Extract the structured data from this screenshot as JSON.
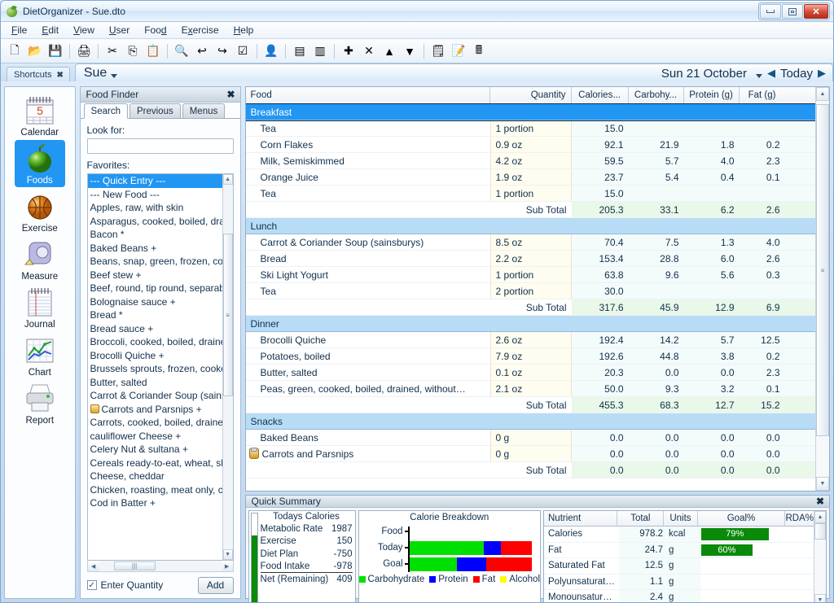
{
  "window": {
    "title": "DietOrganizer - Sue.dto",
    "icon": "apple-icon",
    "buttons": {
      "minimize": "minimize-icon",
      "maximize": "maximize-icon",
      "close": "✕"
    }
  },
  "menubar": {
    "items": [
      "File",
      "Edit",
      "View",
      "User",
      "Food",
      "Exercise",
      "Help"
    ]
  },
  "toolbar": {
    "items": [
      {
        "name": "new-file-icon",
        "glyph": "🗋"
      },
      {
        "name": "open-folder-icon",
        "glyph": "📂"
      },
      {
        "name": "save-icon",
        "glyph": "💾"
      },
      {
        "sep": true
      },
      {
        "name": "print-icon",
        "glyph": "🖨"
      },
      {
        "sep": true
      },
      {
        "name": "cut-icon",
        "glyph": "✂"
      },
      {
        "name": "copy-icon",
        "glyph": "⎘"
      },
      {
        "name": "paste-icon",
        "glyph": "📋"
      },
      {
        "sep": true
      },
      {
        "name": "search-icon",
        "glyph": "🔍"
      },
      {
        "name": "undo-icon",
        "glyph": "↩"
      },
      {
        "name": "redo-icon",
        "glyph": "↪"
      },
      {
        "name": "checklist-icon",
        "glyph": "☑"
      },
      {
        "sep": true
      },
      {
        "name": "user-icon",
        "glyph": "👤"
      },
      {
        "sep": true
      },
      {
        "name": "split-vertical-icon",
        "glyph": "▤"
      },
      {
        "name": "split-horizontal-icon",
        "glyph": "▥"
      },
      {
        "sep": true
      },
      {
        "name": "add-icon",
        "glyph": "✚"
      },
      {
        "name": "delete-icon",
        "glyph": "✕"
      },
      {
        "name": "move-up-icon",
        "glyph": "▲"
      },
      {
        "name": "move-down-icon",
        "glyph": "▼"
      },
      {
        "sep": true
      },
      {
        "name": "notes-icon",
        "glyph": "🗒"
      },
      {
        "name": "edit-note-icon",
        "glyph": "📝"
      },
      {
        "name": "calculator-icon",
        "glyph": "🖩"
      }
    ]
  },
  "shortcuts_tab": {
    "label": "Shortcuts",
    "close": "✖"
  },
  "user_bar": {
    "name": "Sue"
  },
  "date_nav": {
    "date": "Sun 21 October",
    "prev": "◀",
    "today": "Today",
    "next": "▶"
  },
  "rail": {
    "items": [
      {
        "label": "Calendar",
        "icon": "calendar-icon",
        "selected": false
      },
      {
        "label": "Foods",
        "icon": "apple-icon",
        "selected": true
      },
      {
        "label": "Exercise",
        "icon": "basketball-icon",
        "selected": false
      },
      {
        "label": "Measure",
        "icon": "tape-measure-icon",
        "selected": false
      },
      {
        "label": "Journal",
        "icon": "notebook-icon",
        "selected": false
      },
      {
        "label": "Chart",
        "icon": "line-chart-icon",
        "selected": false
      },
      {
        "label": "Report",
        "icon": "printer-icon",
        "selected": false
      }
    ]
  },
  "food_finder": {
    "caption": "Food Finder",
    "close": "✖",
    "tabs": [
      {
        "label": "Search",
        "active": true
      },
      {
        "label": "Previous",
        "active": false
      },
      {
        "label": "Menus",
        "active": false
      }
    ],
    "look_for_label": "Look for:",
    "look_for_value": "",
    "look_for_placeholder": "",
    "favorites_label": "Favorites:",
    "favorites": [
      {
        "label": "--- Quick Entry ---",
        "selected": true,
        "icon": ""
      },
      {
        "label": "--- New Food ---",
        "selected": false,
        "icon": ""
      },
      {
        "label": "Apples, raw, with skin",
        "selected": false,
        "icon": ""
      },
      {
        "label": "Asparagus, cooked, boiled, drain",
        "selected": false,
        "icon": ""
      },
      {
        "label": "Bacon *",
        "selected": false,
        "icon": ""
      },
      {
        "label": "Baked Beans +",
        "selected": false,
        "icon": ""
      },
      {
        "label": "Beans, snap, green, frozen, cook",
        "selected": false,
        "icon": ""
      },
      {
        "label": "Beef stew +",
        "selected": false,
        "icon": ""
      },
      {
        "label": "Beef, round, tip round, separable",
        "selected": false,
        "icon": ""
      },
      {
        "label": "Bolognaise sauce +",
        "selected": false,
        "icon": ""
      },
      {
        "label": "Bread *",
        "selected": false,
        "icon": ""
      },
      {
        "label": "Bread sauce +",
        "selected": false,
        "icon": ""
      },
      {
        "label": "Broccoli, cooked, boiled, drained,",
        "selected": false,
        "icon": ""
      },
      {
        "label": "Brocolli Quiche +",
        "selected": false,
        "icon": ""
      },
      {
        "label": "Brussels sprouts, frozen, cooked",
        "selected": false,
        "icon": ""
      },
      {
        "label": "Butter, salted",
        "selected": false,
        "icon": ""
      },
      {
        "label": "Carrot & Coriander Soup (sainsbu",
        "selected": false,
        "icon": ""
      },
      {
        "label": "Carrots and Parsnips +",
        "selected": false,
        "icon": "jar-icon"
      },
      {
        "label": "Carrots, cooked, boiled, drained,",
        "selected": false,
        "icon": ""
      },
      {
        "label": "cauliflower Cheese +",
        "selected": false,
        "icon": ""
      },
      {
        "label": "Celery Nut & sultana +",
        "selected": false,
        "icon": ""
      },
      {
        "label": "Cereals ready-to-eat, wheat, shre",
        "selected": false,
        "icon": ""
      },
      {
        "label": "Cheese, cheddar",
        "selected": false,
        "icon": ""
      },
      {
        "label": "Chicken, roasting, meat only, coo",
        "selected": false,
        "icon": ""
      },
      {
        "label": "Cod in Batter +",
        "selected": false,
        "icon": ""
      }
    ],
    "enter_quantity_label": "Enter Quantity",
    "enter_quantity_checked": true,
    "add_button": "Add"
  },
  "food_grid": {
    "columns": [
      "Food",
      "Quantity",
      "Calories...",
      "Carbohy...",
      "Protein (g)",
      "Fat (g)"
    ],
    "sections": [
      {
        "name": "Breakfast",
        "selected": true,
        "rows": [
          {
            "food": "Tea",
            "qty": "1 portion",
            "cal": "15.0",
            "carb": "",
            "pro": "",
            "fat": "",
            "icon": ""
          },
          {
            "food": "Corn Flakes",
            "qty": "0.9 oz",
            "cal": "92.1",
            "carb": "21.9",
            "pro": "1.8",
            "fat": "0.2",
            "icon": ""
          },
          {
            "food": "Milk, Semiskimmed",
            "qty": "4.2 oz",
            "cal": "59.5",
            "carb": "5.7",
            "pro": "4.0",
            "fat": "2.3",
            "icon": ""
          },
          {
            "food": "Orange Juice",
            "qty": "1.9 oz",
            "cal": "23.7",
            "carb": "5.4",
            "pro": "0.4",
            "fat": "0.1",
            "icon": ""
          },
          {
            "food": "Tea",
            "qty": "1 portion",
            "cal": "15.0",
            "carb": "",
            "pro": "",
            "fat": "",
            "icon": ""
          }
        ],
        "subtotal": {
          "label": "Sub Total",
          "cal": "205.3",
          "carb": "33.1",
          "pro": "6.2",
          "fat": "2.6"
        }
      },
      {
        "name": "Lunch",
        "selected": false,
        "rows": [
          {
            "food": "Carrot & Coriander Soup (sainsburys)",
            "qty": "8.5 oz",
            "cal": "70.4",
            "carb": "7.5",
            "pro": "1.3",
            "fat": "4.0",
            "icon": ""
          },
          {
            "food": "Bread",
            "qty": "2.2 oz",
            "cal": "153.4",
            "carb": "28.8",
            "pro": "6.0",
            "fat": "2.6",
            "icon": ""
          },
          {
            "food": "Ski Light Yogurt",
            "qty": "1 portion",
            "cal": "63.8",
            "carb": "9.6",
            "pro": "5.6",
            "fat": "0.3",
            "icon": ""
          },
          {
            "food": "Tea",
            "qty": "2 portion",
            "cal": "30.0",
            "carb": "",
            "pro": "",
            "fat": "",
            "icon": ""
          }
        ],
        "subtotal": {
          "label": "Sub Total",
          "cal": "317.6",
          "carb": "45.9",
          "pro": "12.9",
          "fat": "6.9"
        }
      },
      {
        "name": "Dinner",
        "selected": false,
        "rows": [
          {
            "food": "Brocolli Quiche",
            "qty": "2.6 oz",
            "cal": "192.4",
            "carb": "14.2",
            "pro": "5.7",
            "fat": "12.5",
            "icon": ""
          },
          {
            "food": "Potatoes, boiled",
            "qty": "7.9 oz",
            "cal": "192.6",
            "carb": "44.8",
            "pro": "3.8",
            "fat": "0.2",
            "icon": ""
          },
          {
            "food": "Butter, salted",
            "qty": "0.1 oz",
            "cal": "20.3",
            "carb": "0.0",
            "pro": "0.0",
            "fat": "2.3",
            "icon": ""
          },
          {
            "food": "Peas, green, cooked, boiled, drained, without…",
            "qty": "2.1 oz",
            "cal": "50.0",
            "carb": "9.3",
            "pro": "3.2",
            "fat": "0.1",
            "icon": ""
          }
        ],
        "subtotal": {
          "label": "Sub Total",
          "cal": "455.3",
          "carb": "68.3",
          "pro": "12.7",
          "fat": "15.2"
        }
      },
      {
        "name": "Snacks",
        "selected": false,
        "rows": [
          {
            "food": "Baked Beans",
            "qty": "0 g",
            "cal": "0.0",
            "carb": "0.0",
            "pro": "0.0",
            "fat": "0.0",
            "icon": ""
          },
          {
            "food": "Carrots and Parsnips",
            "qty": "0 g",
            "cal": "0.0",
            "carb": "0.0",
            "pro": "0.0",
            "fat": "0.0",
            "icon": "jar-icon"
          }
        ],
        "subtotal": {
          "label": "Sub Total",
          "cal": "0.0",
          "carb": "0.0",
          "pro": "0.0",
          "fat": "0.0"
        }
      }
    ]
  },
  "quick_summary": {
    "caption": "Quick Summary",
    "close": "✖",
    "todays_calories": {
      "title": "Todays Calories",
      "rows": [
        {
          "label": "Metabolic Rate",
          "value": "1987"
        },
        {
          "label": "Exercise",
          "value": "150"
        },
        {
          "label": "Diet Plan",
          "value": "-750"
        },
        {
          "label": "Food Intake",
          "value": "-978"
        },
        {
          "label": "Net (Remaining)",
          "value": "409"
        }
      ]
    },
    "chart_data": {
      "type": "bar",
      "title": "Calorie Breakdown",
      "orientation": "horizontal",
      "stacked": true,
      "categories": [
        "Food",
        "Today",
        "Goal"
      ],
      "legend": [
        "Carbohydrate",
        "Protein",
        "Fat",
        "Alcohol"
      ],
      "legend_position": "bottom",
      "colors": {
        "Carbohydrate": "#00e000",
        "Protein": "#0000ff",
        "Fat": "#ff0000",
        "Alcohol": "#ffff00"
      },
      "series": [
        {
          "name": "Carbohydrate",
          "values": [
            0,
            61,
            39
          ]
        },
        {
          "name": "Protein",
          "values": [
            0,
            14,
            24
          ]
        },
        {
          "name": "Fat",
          "values": [
            0,
            25,
            37
          ]
        },
        {
          "name": "Alcohol",
          "values": [
            0,
            0,
            0
          ]
        }
      ],
      "xlabel": "",
      "ylabel": "",
      "grid": false
    },
    "nutrients": {
      "columns": [
        "Nutrient",
        "Total",
        "Units",
        "Goal%",
        "RDA%"
      ],
      "rows": [
        {
          "nutrient": "Calories",
          "total": "978.2",
          "units": "kcal",
          "goal": "79%",
          "goal_pct": 79,
          "rda": ""
        },
        {
          "nutrient": "Fat",
          "total": "24.7",
          "units": "g",
          "goal": "60%",
          "goal_pct": 60,
          "rda": ""
        },
        {
          "nutrient": "Saturated Fat",
          "total": "12.5",
          "units": "g",
          "goal": "",
          "goal_pct": 0,
          "rda": ""
        },
        {
          "nutrient": "Polyunsaturat…",
          "total": "1.1",
          "units": "g",
          "goal": "",
          "goal_pct": 0,
          "rda": ""
        },
        {
          "nutrient": "Monounsatur…",
          "total": "2.4",
          "units": "g",
          "goal": "",
          "goal_pct": 0,
          "rda": ""
        }
      ]
    }
  },
  "colors": {
    "accent": "#2196f3",
    "goal_bar": "#0a8a0a",
    "group_header": "#b9dcf6",
    "qty_cell": "#fefdf0",
    "num_cell": "#f4fbfb",
    "subtotal_cell": "#e9f8e9"
  }
}
